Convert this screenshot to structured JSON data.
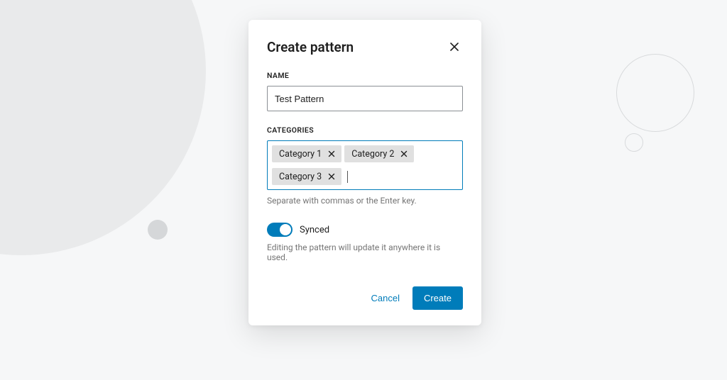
{
  "modal": {
    "title": "Create pattern",
    "name_field": {
      "label": "NAME",
      "value": "Test Pattern"
    },
    "categories_field": {
      "label": "CATEGORIES",
      "tags": [
        "Category 1",
        "Category 2",
        "Category 3"
      ],
      "helper": "Separate with commas or the Enter key."
    },
    "synced": {
      "label": "Synced",
      "on": true,
      "description": "Editing the pattern will update it anywhere it is used."
    },
    "buttons": {
      "cancel": "Cancel",
      "create": "Create"
    }
  },
  "colors": {
    "accent": "#007cba",
    "chip_bg": "#e0e0e0",
    "muted_text": "#757575"
  }
}
